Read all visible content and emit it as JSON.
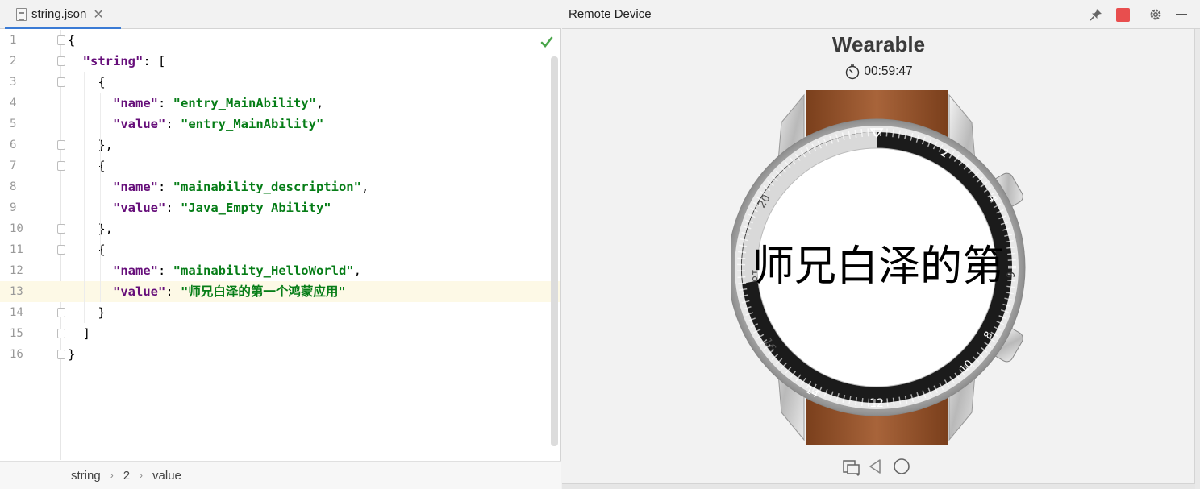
{
  "editor": {
    "tab": {
      "filename": "string.json",
      "close_glyph": "✕"
    },
    "current_line": 13,
    "lines": [
      {
        "n": "1",
        "parts": [
          [
            "p",
            "{"
          ]
        ]
      },
      {
        "n": "2",
        "parts": [
          [
            "p",
            "  "
          ],
          [
            "k",
            "\"string\""
          ],
          [
            "p",
            ": ["
          ]
        ]
      },
      {
        "n": "3",
        "parts": [
          [
            "p",
            "    {"
          ]
        ]
      },
      {
        "n": "4",
        "parts": [
          [
            "p",
            "      "
          ],
          [
            "k",
            "\"name\""
          ],
          [
            "p",
            ": "
          ],
          [
            "s",
            "\"entry_MainAbility\""
          ],
          [
            "p",
            ","
          ]
        ]
      },
      {
        "n": "5",
        "parts": [
          [
            "p",
            "      "
          ],
          [
            "k",
            "\"value\""
          ],
          [
            "p",
            ": "
          ],
          [
            "s",
            "\"entry_MainAbility\""
          ]
        ]
      },
      {
        "n": "6",
        "parts": [
          [
            "p",
            "    },"
          ]
        ]
      },
      {
        "n": "7",
        "parts": [
          [
            "p",
            "    {"
          ]
        ]
      },
      {
        "n": "8",
        "parts": [
          [
            "p",
            "      "
          ],
          [
            "k",
            "\"name\""
          ],
          [
            "p",
            ": "
          ],
          [
            "s",
            "\"mainability_description\""
          ],
          [
            "p",
            ","
          ]
        ]
      },
      {
        "n": "9",
        "parts": [
          [
            "p",
            "      "
          ],
          [
            "k",
            "\"value\""
          ],
          [
            "p",
            ": "
          ],
          [
            "s",
            "\"Java_Empty Ability\""
          ]
        ]
      },
      {
        "n": "10",
        "parts": [
          [
            "p",
            "    },"
          ]
        ]
      },
      {
        "n": "11",
        "parts": [
          [
            "p",
            "    {"
          ]
        ]
      },
      {
        "n": "12",
        "parts": [
          [
            "p",
            "      "
          ],
          [
            "k",
            "\"name\""
          ],
          [
            "p",
            ": "
          ],
          [
            "s",
            "\"mainability_HelloWorld\""
          ],
          [
            "p",
            ","
          ]
        ]
      },
      {
        "n": "13",
        "parts": [
          [
            "p",
            "      "
          ],
          [
            "k",
            "\"value\""
          ],
          [
            "p",
            ": "
          ],
          [
            "s",
            "\"师兄白泽的第一个鸿蒙应用\""
          ]
        ]
      },
      {
        "n": "14",
        "parts": [
          [
            "p",
            "    }"
          ]
        ]
      },
      {
        "n": "15",
        "parts": [
          [
            "p",
            "  ]"
          ]
        ]
      },
      {
        "n": "16",
        "parts": [
          [
            "p",
            "}"
          ]
        ]
      }
    ],
    "breadcrumb": [
      "string",
      "2",
      "value"
    ]
  },
  "remote": {
    "title": "Remote Device",
    "device_name": "Wearable",
    "timer": "00:59:47",
    "screen_text": "师兄白泽的第",
    "buttons": [
      "pin-icon",
      "stop-icon",
      "gear-icon",
      "minimize-icon"
    ],
    "nav_icons": [
      "rotate-icon",
      "back-icon",
      "home-icon"
    ]
  },
  "colors": {
    "key": "#660e7a",
    "string": "#067d17",
    "stop": "#e84e4e",
    "tab_underline": "#3a7bd5",
    "current_line_bg": "#fdf9e6",
    "strap": "#9c5a2f"
  }
}
